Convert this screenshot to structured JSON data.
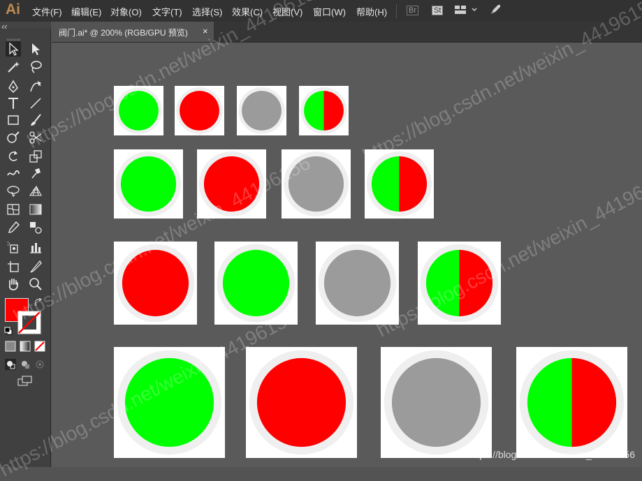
{
  "app": {
    "logo": "Ai"
  },
  "menu": [
    "文件(F)",
    "编辑(E)",
    "对象(O)",
    "文字(T)",
    "选择(S)",
    "效果(C)",
    "视图(V)",
    "窗口(W)",
    "帮助(H)"
  ],
  "menubar_icons": [
    "Br",
    "St"
  ],
  "document_tab": {
    "title": "阀门.ai* @ 200% (RGB/GPU 预览)",
    "close": "×"
  },
  "colors": {
    "green": "#00ff00",
    "red": "#ff0000",
    "grey": "#9b9b9b",
    "ring": "#efefef",
    "card": "#ffffff"
  },
  "indicator_rows": [
    [
      "green",
      "red",
      "grey",
      "split"
    ],
    [
      "green",
      "red",
      "grey",
      "split"
    ],
    [
      "red",
      "green",
      "grey",
      "split"
    ],
    [
      "green",
      "red",
      "grey",
      "split"
    ]
  ],
  "watermark": {
    "text": "https://blog.csdn.net/weixin_44196156"
  },
  "credit": "https://blog.csdn.net/weixin_44196156"
}
